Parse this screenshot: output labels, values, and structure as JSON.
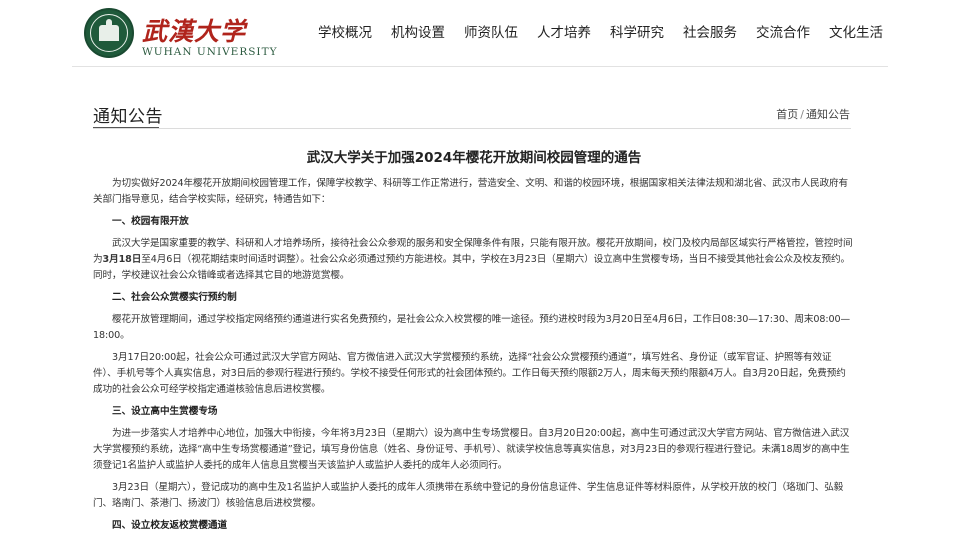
{
  "header": {
    "logo_cn": "武漢大学",
    "logo_en": "WUHAN UNIVERSITY",
    "nav": [
      {
        "label": "学校概况"
      },
      {
        "label": "机构设置"
      },
      {
        "label": "师资队伍"
      },
      {
        "label": "人才培养"
      },
      {
        "label": "科学研究"
      },
      {
        "label": "社会服务"
      },
      {
        "label": "交流合作"
      },
      {
        "label": "文化生活"
      }
    ]
  },
  "section": {
    "title": "通知公告",
    "breadcrumb": {
      "home": "首页",
      "separator": "/",
      "current": "通知公告"
    }
  },
  "article": {
    "title": "武汉大学关于加强2024年樱花开放期间校园管理的通告",
    "intro": "为切实做好2024年樱花开放期间校园管理工作，保障学校教学、科研等工作正常进行，营造安全、文明、和谐的校园环境，根据国家相关法律法规和湖北省、武汉市人民政府有关部门指导意见，结合学校实际，经研究，特通告如下：",
    "h1": "一、校园有限开放",
    "p1a": "武汉大学是国家重要的教学、科研和人才培养场所，接待社会公众参观的服务和安全保障条件有限，只能有限开放。樱花开放期间，校门及校内局部区域实行严格管控，管控时间为",
    "p1b": "3月18日",
    "p1c": "至4月6日（视花期结束时间适时调整）。社会公众必须通过预约方能进校。其中，学校在3月23日（星期六）设立高中生赏樱专场，当日不接受其他社会公众及校友预约。同时，学校建议社会公众错峰或者选择其它目的地游览赏樱。",
    "h2": "二、社会公众赏樱实行预约制",
    "p2": "樱花开放管理期间，通过学校指定网络预约通道进行实名免费预约，是社会公众入校赏樱的唯一途径。预约进校时段为3月20日至4月6日，工作日08:30—17:30、周末08:00—18:00。",
    "p3": "3月17日20:00起，社会公众可通过武汉大学官方网站、官方微信进入武汉大学赏樱预约系统，选择“社会公众赏樱预约通道”，填写姓名、身份证（或军官证、护照等有效证件）、手机号等个人真实信息，对3日后的参观行程进行预约。学校不接受任何形式的社会团体预约。工作日每天预约限额2万人，周末每天预约限额4万人。自3月20日起，免费预约成功的社会公众可经学校指定通道核验信息后进校赏樱。",
    "h3": "三、设立高中生赏樱专场",
    "p4": "为进一步落实人才培养中心地位，加强大中衔接，今年将3月23日（星期六）设为高中生专场赏樱日。自3月20日20:00起，高中生可通过武汉大学官方网站、官方微信进入武汉大学赏樱预约系统，选择“高中生专场赏樱通道”登记，填写身份信息（姓名、身份证号、手机号）、就读学校信息等真实信息，对3月23日的参观行程进行登记。未满18周岁的高中生须登记1名监护人或监护人委托的成年人信息且赏樱当天该监护人或监护人委托的成年人必须同行。",
    "p5": "3月23日（星期六），登记成功的高中生及1名监护人或监护人委托的成年人须携带在系统中登记的身份信息证件、学生信息证件等材料原件，从学校开放的校门（珞珈门、弘毅门、珞南门、茶港门、扬波门）核验信息后进校赏樱。",
    "h4": "四、设立校友返校赏樱通道"
  }
}
